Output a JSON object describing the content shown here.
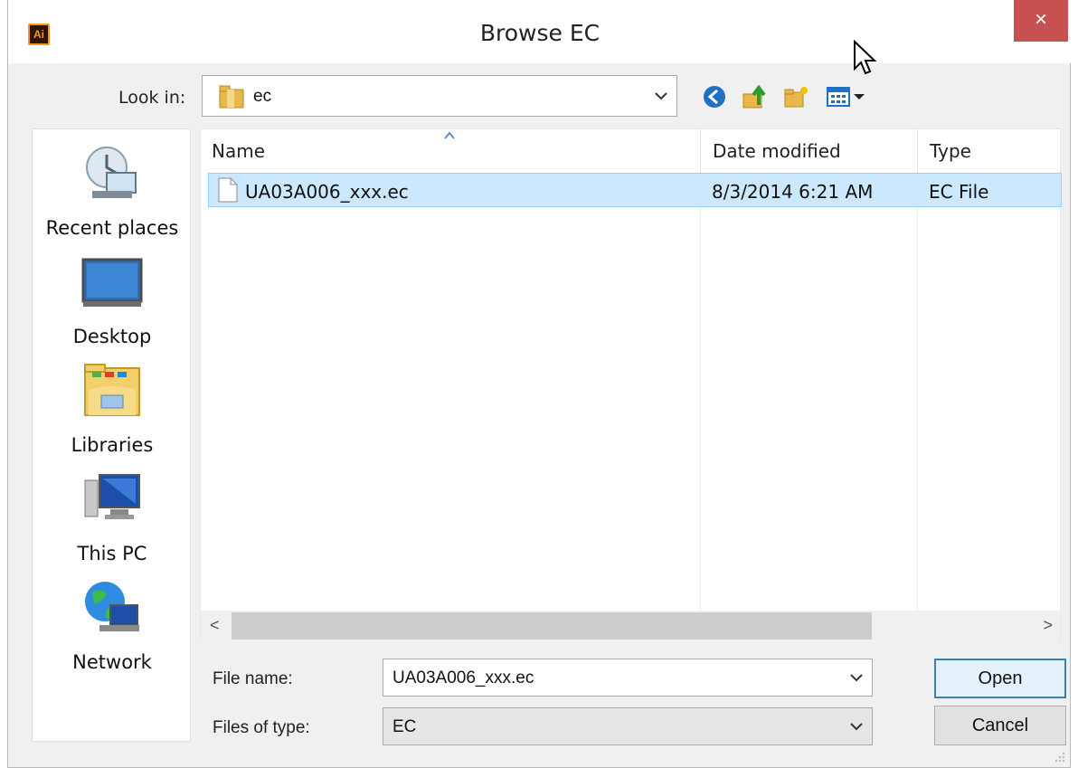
{
  "window": {
    "title": "Browse EC",
    "app_icon_text": "Ai",
    "close_glyph": "×"
  },
  "toolbar": {
    "look_in_label": "Look in:",
    "look_in_value": "ec",
    "icons": [
      "back-icon",
      "up-folder-icon",
      "new-folder-icon",
      "view-menu-icon"
    ]
  },
  "places": [
    {
      "label": "Recent places",
      "icon": "recent-places-icon"
    },
    {
      "label": "Desktop",
      "icon": "desktop-icon"
    },
    {
      "label": "Libraries",
      "icon": "libraries-icon"
    },
    {
      "label": "This PC",
      "icon": "this-pc-icon"
    },
    {
      "label": "Network",
      "icon": "network-icon"
    }
  ],
  "file_list": {
    "columns": [
      "Name",
      "Date modified",
      "Type"
    ],
    "rows": [
      {
        "name": "UA03A006_xxx.ec",
        "date": "8/3/2014 6:21 AM",
        "type": "EC File"
      }
    ]
  },
  "form": {
    "file_name_label": "File name:",
    "file_name_value": "UA03A006_xxx.ec",
    "file_type_label": "Files of type:",
    "file_type_value": "EC",
    "open_label": "Open",
    "cancel_label": "Cancel"
  },
  "scrollbar": {
    "left_glyph": "<",
    "right_glyph": ">"
  },
  "colors": {
    "accent": "#cce8ff",
    "close": "#c75050",
    "default_button_border": "#3c7fb1"
  }
}
